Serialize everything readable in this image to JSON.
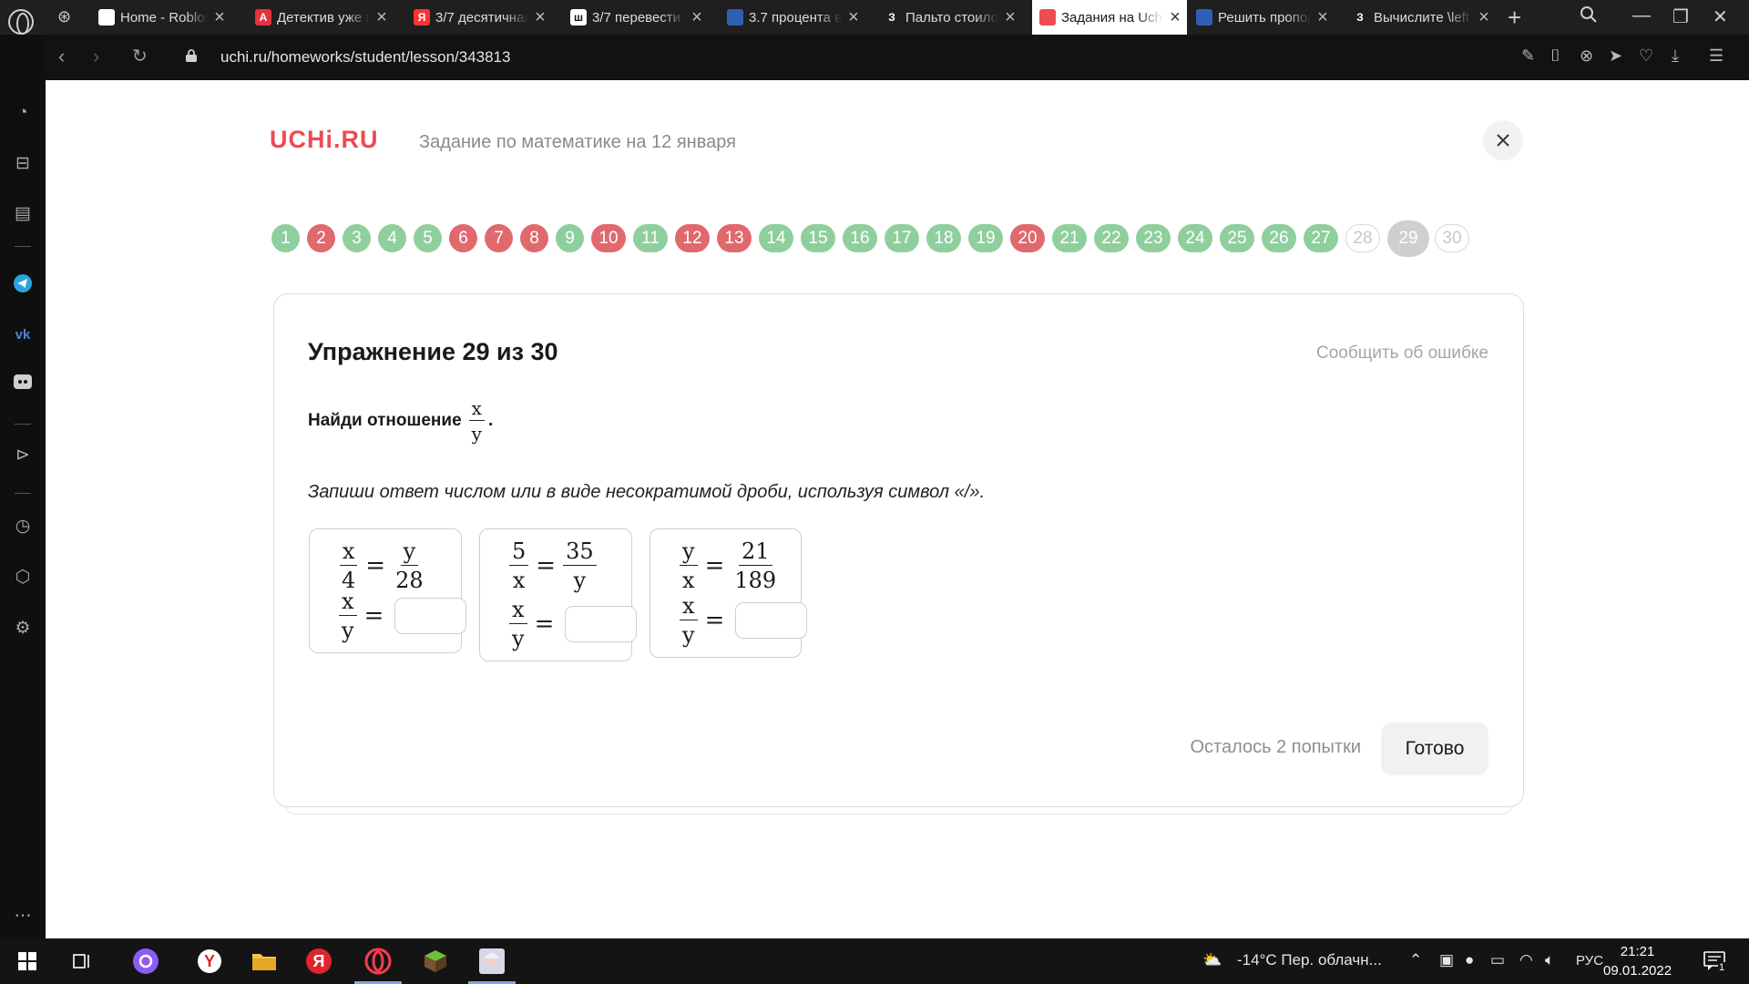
{
  "browser": {
    "tabs": [
      {
        "title": "Home - Roblox",
        "favicon": "roblox-icon",
        "fav_color": "#ffffff",
        "fav_text": "",
        "active": false
      },
      {
        "title": "Детектив уже м",
        "favicon": "avito-a-icon",
        "fav_color": "#e8323c",
        "fav_text": "A",
        "active": false
      },
      {
        "title": "3/7 десятичная",
        "favicon": "yandex-icon",
        "fav_color": "#f33",
        "fav_text": "Я",
        "active": false
      },
      {
        "title": "3/7 перевести",
        "favicon": "school-icon",
        "fav_color": "#ffffff",
        "fav_text": "ш",
        "active": false
      },
      {
        "title": "3.7 процента в",
        "favicon": "blue-grid-icon",
        "fav_color": "#2f5fb5",
        "fav_text": "",
        "active": false
      },
      {
        "title": "Пальто стоило",
        "favicon": "znanija-icon",
        "fav_color": "#1f1f1f",
        "fav_text": "З",
        "active": false
      },
      {
        "title": "Задания на Uch",
        "favicon": "uchi-icon",
        "fav_color": "#ee4b53",
        "fav_text": "",
        "active": true
      },
      {
        "title": "Решить пропор",
        "favicon": "calc-grid-icon",
        "fav_color": "#2f5fb5",
        "fav_text": "",
        "active": false
      },
      {
        "title": "Вычислите \\left",
        "favicon": "znanija-icon",
        "fav_color": "#1f1f1f",
        "fav_text": "З",
        "active": false
      }
    ],
    "url": "uchi.ru/homeworks/student/lesson/343813"
  },
  "page": {
    "brand": "UCHi.RU",
    "title": "Задание по математике на 12 января",
    "tasks": [
      {
        "n": "1",
        "s": "ok"
      },
      {
        "n": "2",
        "s": "bad"
      },
      {
        "n": "3",
        "s": "ok"
      },
      {
        "n": "4",
        "s": "ok"
      },
      {
        "n": "5",
        "s": "ok"
      },
      {
        "n": "6",
        "s": "bad"
      },
      {
        "n": "7",
        "s": "bad"
      },
      {
        "n": "8",
        "s": "bad"
      },
      {
        "n": "9",
        "s": "ok"
      },
      {
        "n": "10",
        "s": "bad"
      },
      {
        "n": "11",
        "s": "ok"
      },
      {
        "n": "12",
        "s": "bad"
      },
      {
        "n": "13",
        "s": "bad"
      },
      {
        "n": "14",
        "s": "ok"
      },
      {
        "n": "15",
        "s": "ok"
      },
      {
        "n": "16",
        "s": "ok"
      },
      {
        "n": "17",
        "s": "ok"
      },
      {
        "n": "18",
        "s": "ok"
      },
      {
        "n": "19",
        "s": "ok"
      },
      {
        "n": "20",
        "s": "bad"
      },
      {
        "n": "21",
        "s": "ok"
      },
      {
        "n": "22",
        "s": "ok"
      },
      {
        "n": "23",
        "s": "ok"
      },
      {
        "n": "24",
        "s": "ok"
      },
      {
        "n": "25",
        "s": "ok"
      },
      {
        "n": "26",
        "s": "ok"
      },
      {
        "n": "27",
        "s": "ok"
      },
      {
        "n": "28",
        "s": "todo"
      },
      {
        "n": "29",
        "s": "current"
      },
      {
        "n": "30",
        "s": "todo"
      }
    ],
    "exercise_title": "Упражнение 29 из 30",
    "report_error": "Сообщить об ошибке",
    "task_text": "Найди отношение",
    "task_frac": {
      "num": "x",
      "den": "y"
    },
    "task_end": ".",
    "hint": "Запиши ответ числом или в виде несократимой дроби, используя символ «/».",
    "problems": [
      {
        "lhs": {
          "num": "x",
          "den": "4"
        },
        "rhs": {
          "num": "y",
          "den": "28"
        },
        "ask": {
          "num": "x",
          "den": "y"
        },
        "eq": "="
      },
      {
        "lhs": {
          "num": "5",
          "den": "x"
        },
        "rhs": {
          "num": "35",
          "den": "y"
        },
        "ask": {
          "num": "x",
          "den": "y"
        },
        "eq": "="
      },
      {
        "lhs": {
          "num": "y",
          "den": "x"
        },
        "rhs": {
          "num": "21",
          "den": "189"
        },
        "ask": {
          "num": "x",
          "den": "y"
        },
        "eq": "="
      }
    ],
    "attempts": "Осталось 2 попытки",
    "done": "Готово"
  },
  "taskbar": {
    "weather": "-14°C  Пер. облачн...",
    "lang": "РУС",
    "time": "21:21",
    "date": "09.01.2022",
    "notifications": "1"
  },
  "colors": {
    "ok": "#8fcf9d",
    "bad": "#e0696e",
    "brand": "#ee4b53"
  }
}
